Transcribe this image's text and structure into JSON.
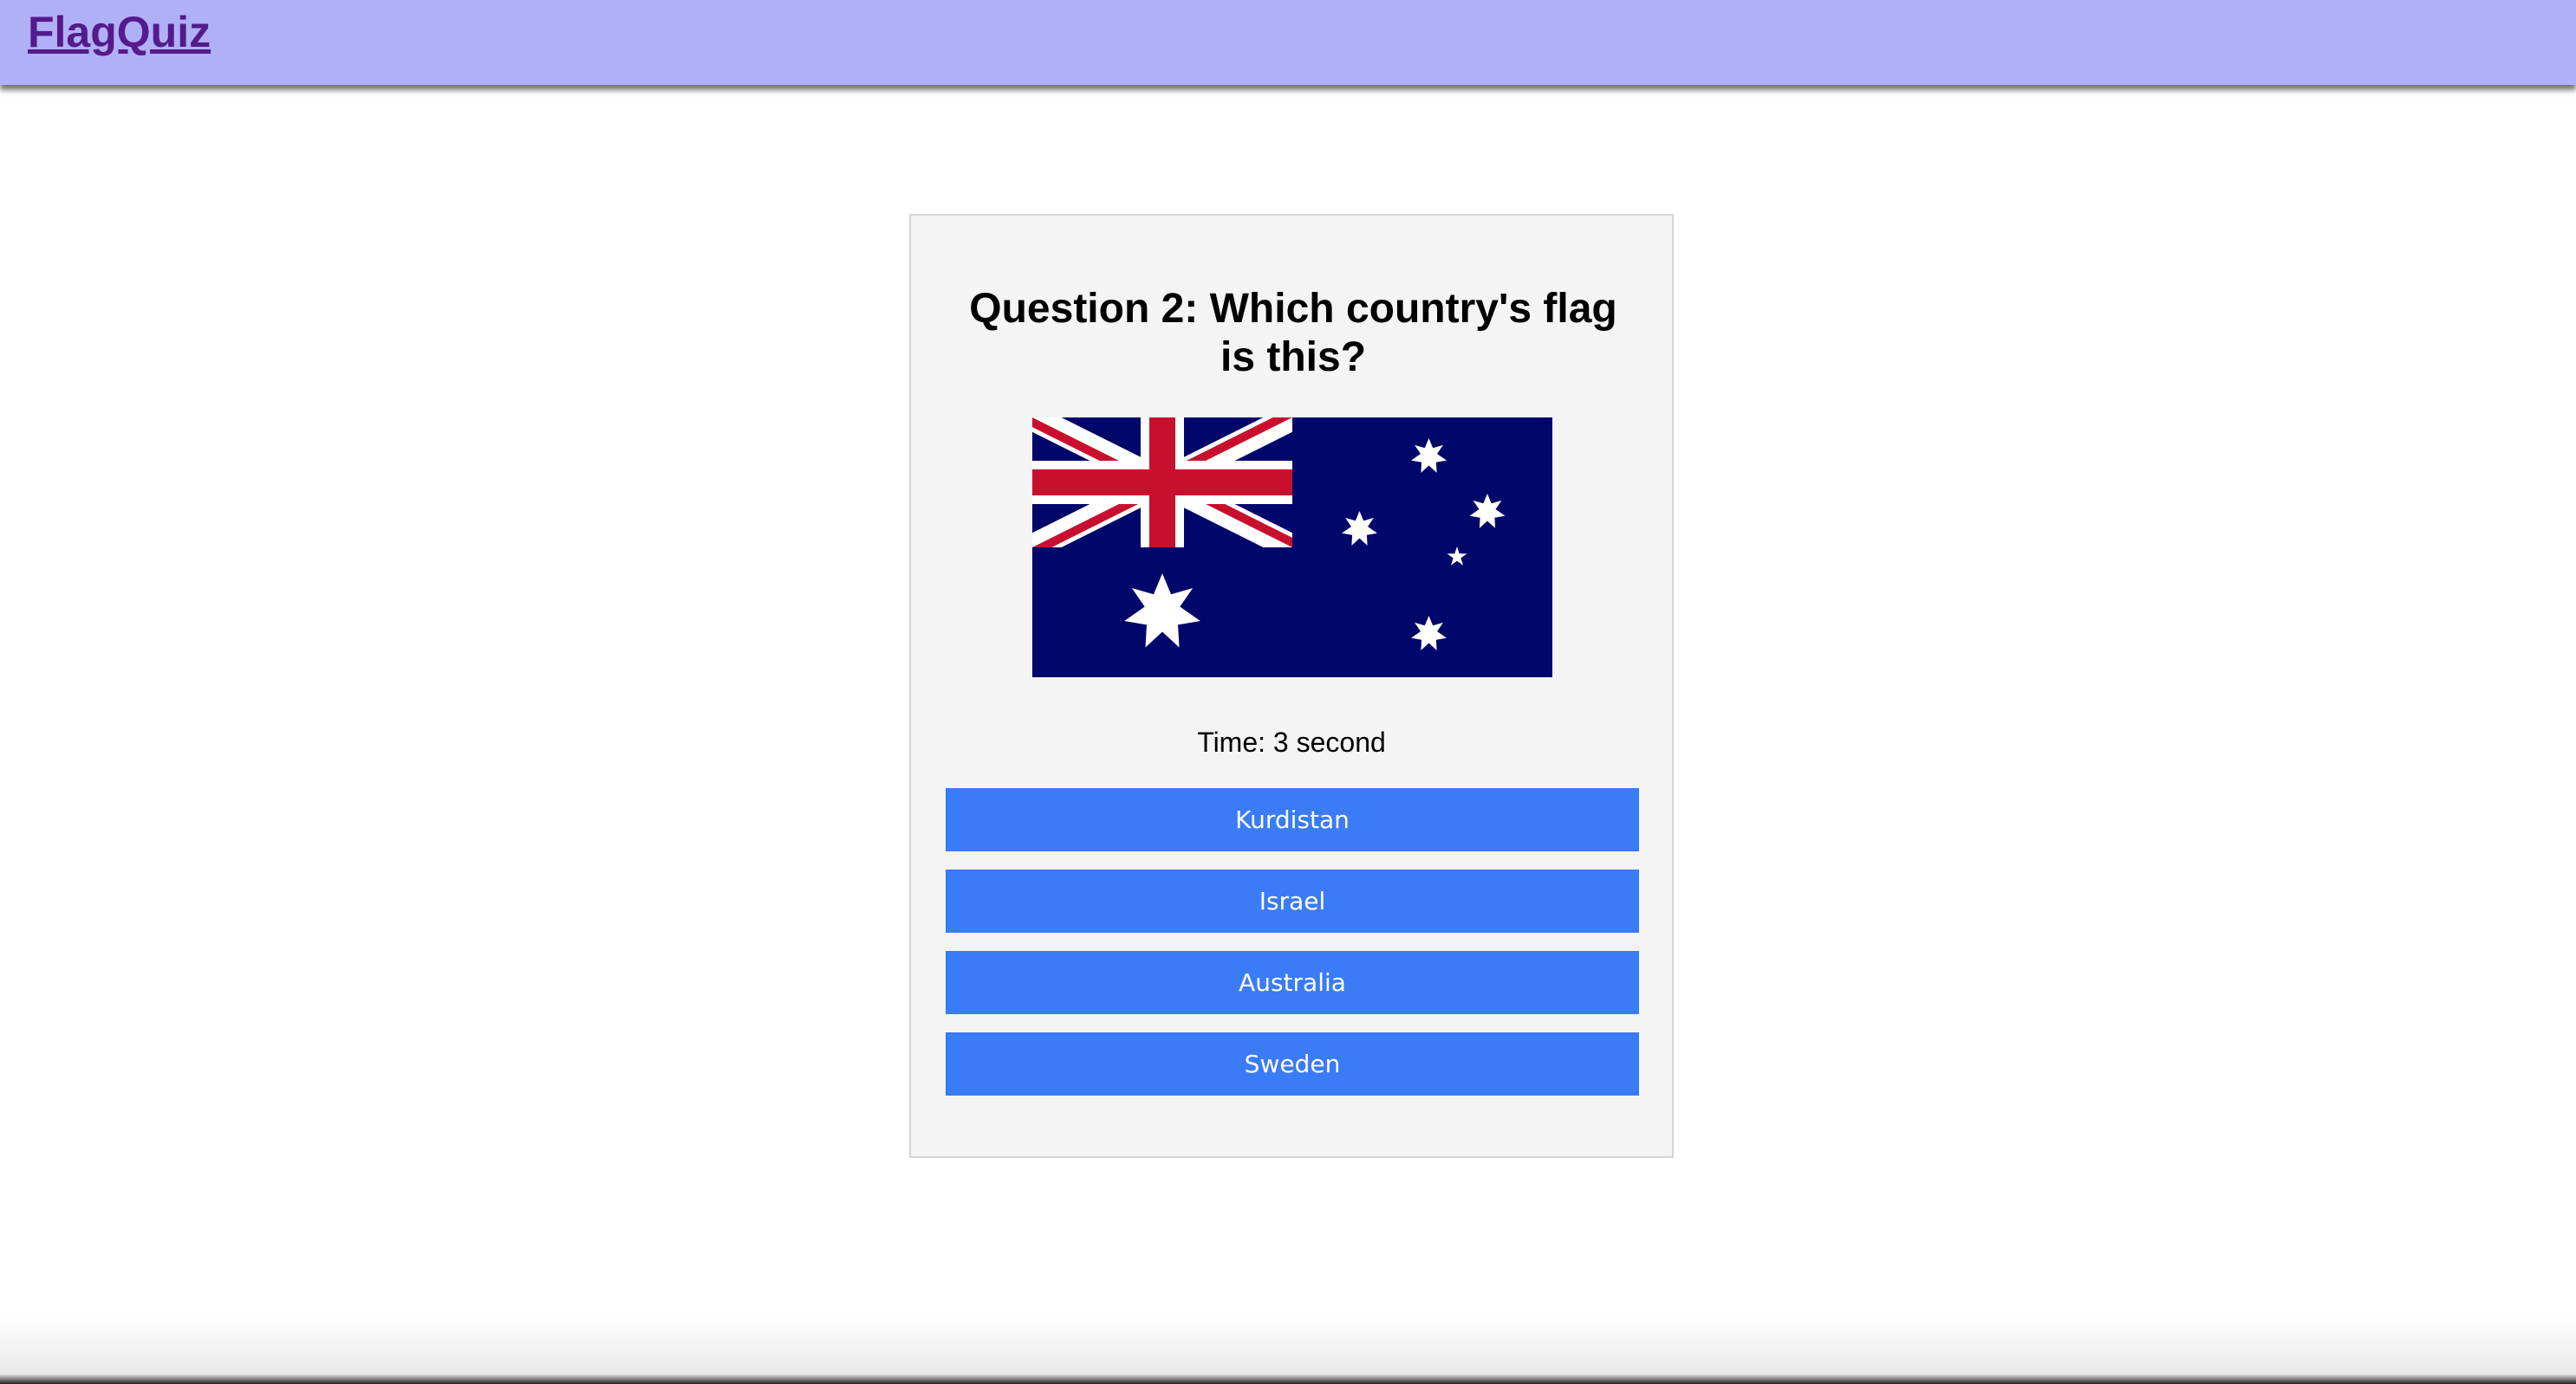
{
  "header": {
    "logo": "FlagQuiz"
  },
  "quiz": {
    "question": "Question 2: Which country's flag is this?",
    "flag_icon": "flag-australia",
    "timer": "Time: 3 second",
    "answers": [
      "Kurdistan",
      "Israel",
      "Australia",
      "Sweden"
    ]
  },
  "colors": {
    "header_bg": "#b0b0f8",
    "logo": "#551a8b",
    "button_bg": "#3a7bf6",
    "card_bg": "#f4f4f4",
    "flag_blue": "#00076b",
    "flag_red": "#c8102e"
  }
}
